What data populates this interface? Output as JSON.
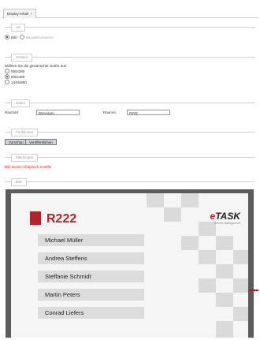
{
  "tab": {
    "label": "Display-Inhalt",
    "close": "×"
  },
  "art": {
    "legend": "Art",
    "options": [
      {
        "label": "Bild",
        "selected": true
      },
      {
        "label": "Beispielszenarien",
        "selected": false
      }
    ]
  },
  "groesse": {
    "legend": "Größen",
    "hint": "Wählen Sie die gewünschte Größe aus:",
    "options": [
      {
        "label": "550x380",
        "selected": false
      },
      {
        "label": "800x480",
        "selected": true
      },
      {
        "label": "1440x900",
        "selected": false
      }
    ]
  },
  "daten": {
    "legend": "Daten",
    "raumart_label": "Raumart",
    "raumart_value": "Büroraum",
    "raumnr_label": "Raumnr.",
    "raumnr_value": "R222"
  },
  "funktionen": {
    "legend": "Funktionen",
    "preview_button": "Vorschau",
    "publish_button": "Veröffentlichen"
  },
  "meldungen": {
    "legend": "Meldungen",
    "message": "Bild wurde erfolgreich erstellt!",
    "message_color": "#e02020"
  },
  "bild": {
    "legend": "Bild",
    "room": "R222",
    "logo_e": "e",
    "logo_task": "TASK",
    "logo_sub": "Service-Management",
    "people": [
      "Michael Müller",
      "Andrea Steffens",
      "Steffanie Schmidt",
      "Martin Peters",
      "Conrad Liefers"
    ],
    "accent_color": "#b4222a"
  }
}
